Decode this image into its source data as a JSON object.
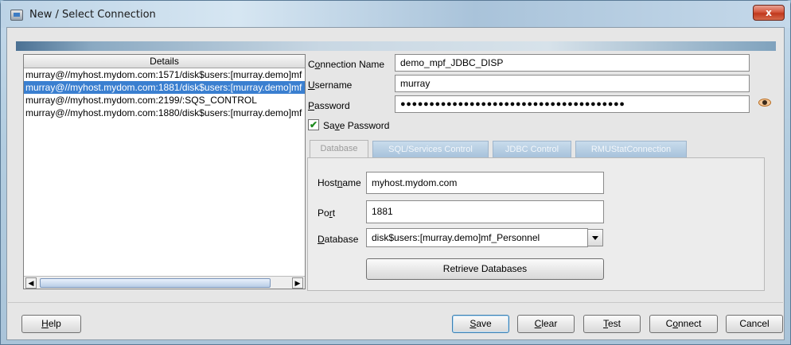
{
  "window": {
    "title": "New / Select Connection",
    "close_label": "x"
  },
  "list": {
    "header": "Details",
    "rows": [
      "murray@//myhost.mydom.com:1571/disk$users:[murray.demo]mf",
      "murray@//myhost.mydom.com:1881/disk$users:[murray.demo]mf",
      "murray@//myhost.mydom.com:2199/:SQS_CONTROL",
      "murray@//myhost.mydom.com:1880/disk$users:[murray.demo]mf"
    ],
    "selected_index": 1
  },
  "form": {
    "connection_name": {
      "label_pre": "C",
      "label_u": "o",
      "label_post": "nnection Name",
      "value": "demo_mpf_JDBC_DISP"
    },
    "username": {
      "label_u": "U",
      "label_post": "sername",
      "value": "murray"
    },
    "password": {
      "label_u": "P",
      "label_post": "assword",
      "value": "●●●●●●●●●●●●●●●●●●●●●●●●●●●●●●●●●●●●●●●"
    },
    "save_password": {
      "label_pre": "Sa",
      "label_u": "v",
      "label_post": "e Password",
      "checked": true,
      "mark": "✔"
    }
  },
  "tabs": [
    {
      "label": "Database",
      "active": true
    },
    {
      "label": "SQL/Services Control",
      "active": false
    },
    {
      "label": "JDBC Control",
      "active": false
    },
    {
      "label": "RMUStatConnection",
      "active": false
    }
  ],
  "database_tab": {
    "hostname": {
      "label_pre": "Host",
      "label_u": "n",
      "label_post": "ame",
      "value": "myhost.mydom.com"
    },
    "port": {
      "label_pre": "Po",
      "label_u": "r",
      "label_post": "t",
      "value": "1881"
    },
    "database": {
      "label_u": "D",
      "label_post": "atabase",
      "value": "disk$users:[murray.demo]mf_Personnel"
    },
    "retrieve_button": "Retrieve Databases"
  },
  "buttons": {
    "help": {
      "u": "H",
      "rest": "elp"
    },
    "save": {
      "u": "S",
      "rest": "ave"
    },
    "clear": {
      "u": "C",
      "rest": "lear"
    },
    "test": {
      "u": "T",
      "rest": "est"
    },
    "connect": {
      "pre": "C",
      "u": "o",
      "rest": "nnect"
    },
    "cancel": "Cancel"
  },
  "scrollbar": {
    "left_arrow": "◀",
    "right_arrow": "▶"
  },
  "colors": {
    "selection": "#3a7fd0",
    "titlebar": "#c4d9ea",
    "close": "#c0381c"
  }
}
